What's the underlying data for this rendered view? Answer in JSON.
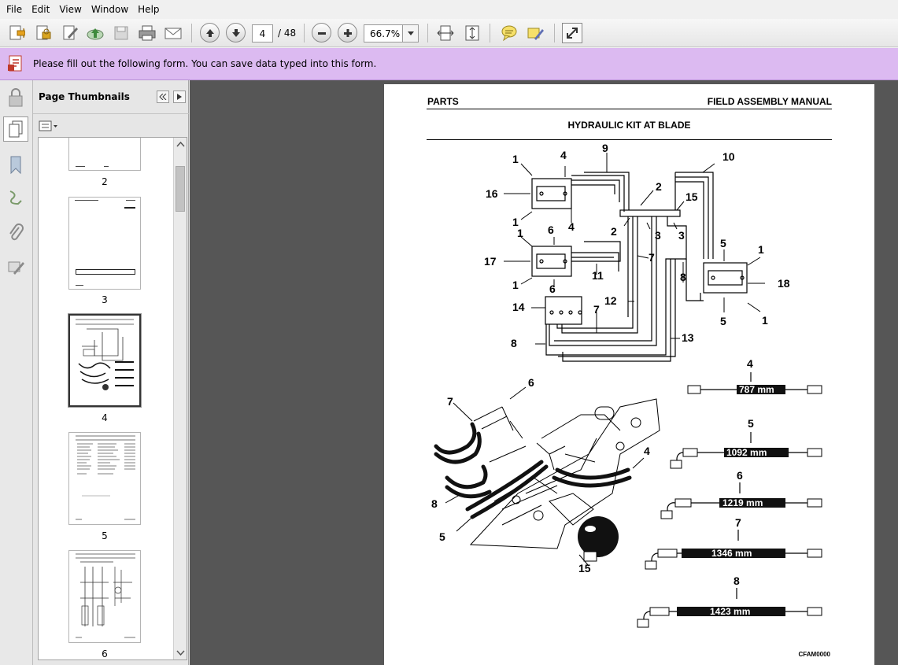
{
  "menu": [
    "File",
    "Edit",
    "View",
    "Window",
    "Help"
  ],
  "toolbar": {
    "icons": [
      "create-pdf-icon",
      "secure-icon",
      "sign-icon",
      "upload-icon",
      "save-icon",
      "print-icon",
      "email-icon",
      "prev-page-icon",
      "next-page-icon",
      "zoom-out-icon",
      "zoom-in-icon",
      "fit-width-icon",
      "fit-page-icon",
      "comment-icon",
      "highlight-icon",
      "expand-icon"
    ],
    "page_current": "4",
    "page_total": "/ 48",
    "zoom": "66.7%"
  },
  "form_bar": {
    "message": "Please fill out the following form. You can save data typed into this form.",
    "color": "#dcbaf1"
  },
  "thumbnails_panel": {
    "title": "Page Thumbnails",
    "pages": [
      "2",
      "3",
      "4",
      "5",
      "6"
    ],
    "selected_page": "4"
  },
  "document": {
    "header_left": "PARTS",
    "header_right": "FIELD ASSEMBLY MANUAL",
    "title": "HYDRAULIC KIT AT BLADE",
    "footer_code": "CFAM0000",
    "hoses": [
      {
        "callout": "4",
        "length": "787 mm"
      },
      {
        "callout": "5",
        "length": "1092 mm"
      },
      {
        "callout": "6",
        "length": "1219 mm"
      },
      {
        "callout": "7",
        "length": "1346 mm"
      },
      {
        "callout": "8",
        "length": "1423 mm"
      }
    ],
    "schematic_callouts": [
      "1",
      "4",
      "9",
      "10",
      "16",
      "2",
      "15",
      "1",
      "4",
      "2",
      "3",
      "3",
      "1",
      "6",
      "5",
      "1",
      "17",
      "7",
      "8",
      "18",
      "1",
      "11",
      "6",
      "5",
      "1",
      "14",
      "12",
      "7",
      "8",
      "13"
    ],
    "pictorial_callouts": [
      "6",
      "7",
      "4",
      "8",
      "5",
      "15"
    ]
  }
}
